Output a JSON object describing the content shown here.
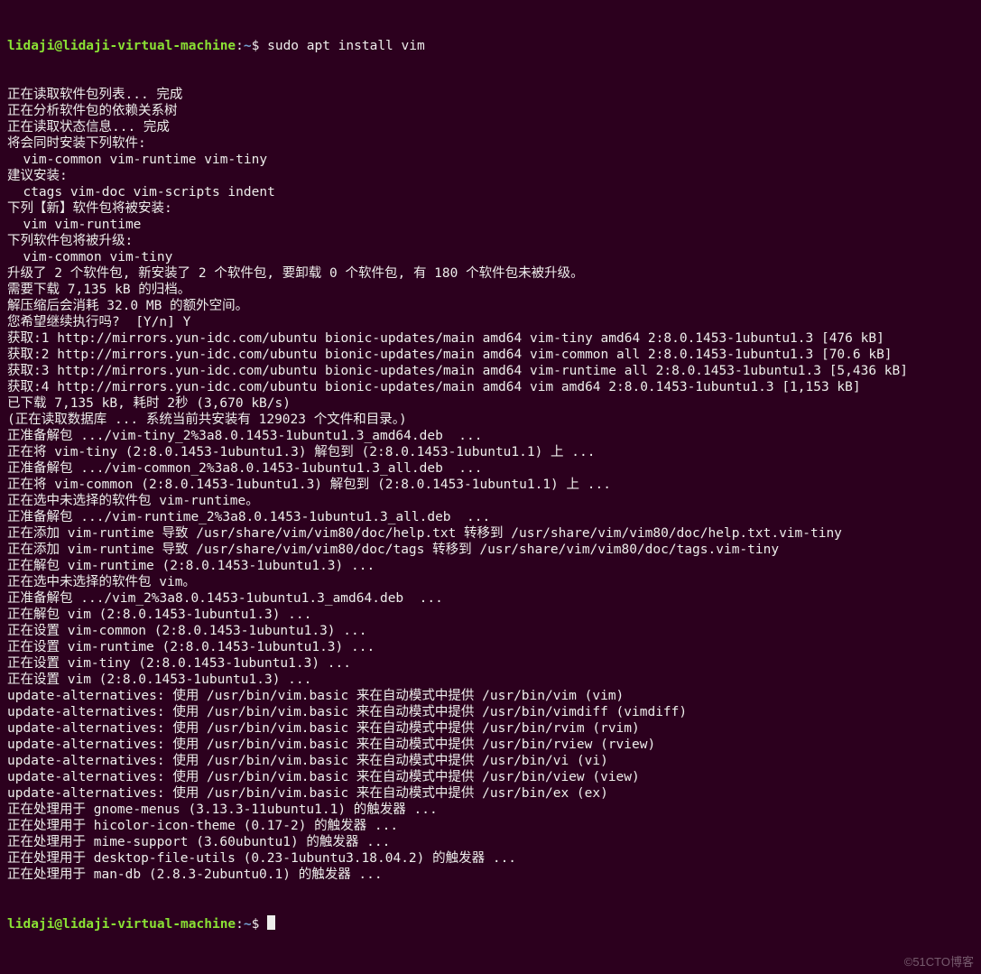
{
  "prompt": {
    "user_host": "lidaji@lidaji-virtual-machine",
    "colon": ":",
    "path": "~",
    "dollar": "$ "
  },
  "command": "sudo apt install vim",
  "lines": [
    "正在读取软件包列表... 完成",
    "正在分析软件包的依赖关系树",
    "正在读取状态信息... 完成",
    "将会同时安装下列软件:",
    "  vim-common vim-runtime vim-tiny",
    "建议安装:",
    "  ctags vim-doc vim-scripts indent",
    "下列【新】软件包将被安装:",
    "  vim vim-runtime",
    "下列软件包将被升级:",
    "  vim-common vim-tiny",
    "升级了 2 个软件包, 新安装了 2 个软件包, 要卸载 0 个软件包, 有 180 个软件包未被升级。",
    "需要下载 7,135 kB 的归档。",
    "解压缩后会消耗 32.0 MB 的额外空间。",
    "您希望继续执行吗?  [Y/n] Y",
    "获取:1 http://mirrors.yun-idc.com/ubuntu bionic-updates/main amd64 vim-tiny amd64 2:8.0.1453-1ubuntu1.3 [476 kB]",
    "获取:2 http://mirrors.yun-idc.com/ubuntu bionic-updates/main amd64 vim-common all 2:8.0.1453-1ubuntu1.3 [70.6 kB]",
    "获取:3 http://mirrors.yun-idc.com/ubuntu bionic-updates/main amd64 vim-runtime all 2:8.0.1453-1ubuntu1.3 [5,436 kB]",
    "获取:4 http://mirrors.yun-idc.com/ubuntu bionic-updates/main amd64 vim amd64 2:8.0.1453-1ubuntu1.3 [1,153 kB]",
    "已下载 7,135 kB, 耗时 2秒 (3,670 kB/s)",
    "(正在读取数据库 ... 系统当前共安装有 129023 个文件和目录。)",
    "正准备解包 .../vim-tiny_2%3a8.0.1453-1ubuntu1.3_amd64.deb  ...",
    "正在将 vim-tiny (2:8.0.1453-1ubuntu1.3) 解包到 (2:8.0.1453-1ubuntu1.1) 上 ...",
    "正准备解包 .../vim-common_2%3a8.0.1453-1ubuntu1.3_all.deb  ...",
    "正在将 vim-common (2:8.0.1453-1ubuntu1.3) 解包到 (2:8.0.1453-1ubuntu1.1) 上 ...",
    "正在选中未选择的软件包 vim-runtime。",
    "正准备解包 .../vim-runtime_2%3a8.0.1453-1ubuntu1.3_all.deb  ...",
    "正在添加 vim-runtime 导致 /usr/share/vim/vim80/doc/help.txt 转移到 /usr/share/vim/vim80/doc/help.txt.vim-tiny",
    "正在添加 vim-runtime 导致 /usr/share/vim/vim80/doc/tags 转移到 /usr/share/vim/vim80/doc/tags.vim-tiny",
    "正在解包 vim-runtime (2:8.0.1453-1ubuntu1.3) ...",
    "正在选中未选择的软件包 vim。",
    "正准备解包 .../vim_2%3a8.0.1453-1ubuntu1.3_amd64.deb  ...",
    "正在解包 vim (2:8.0.1453-1ubuntu1.3) ...",
    "正在设置 vim-common (2:8.0.1453-1ubuntu1.3) ...",
    "正在设置 vim-runtime (2:8.0.1453-1ubuntu1.3) ...",
    "正在设置 vim-tiny (2:8.0.1453-1ubuntu1.3) ...",
    "正在设置 vim (2:8.0.1453-1ubuntu1.3) ...",
    "update-alternatives: 使用 /usr/bin/vim.basic 来在自动模式中提供 /usr/bin/vim (vim)",
    "update-alternatives: 使用 /usr/bin/vim.basic 来在自动模式中提供 /usr/bin/vimdiff (vimdiff)",
    "update-alternatives: 使用 /usr/bin/vim.basic 来在自动模式中提供 /usr/bin/rvim (rvim)",
    "update-alternatives: 使用 /usr/bin/vim.basic 来在自动模式中提供 /usr/bin/rview (rview)",
    "update-alternatives: 使用 /usr/bin/vim.basic 来在自动模式中提供 /usr/bin/vi (vi)",
    "update-alternatives: 使用 /usr/bin/vim.basic 来在自动模式中提供 /usr/bin/view (view)",
    "update-alternatives: 使用 /usr/bin/vim.basic 来在自动模式中提供 /usr/bin/ex (ex)",
    "正在处理用于 gnome-menus (3.13.3-11ubuntu1.1) 的触发器 ...",
    "正在处理用于 hicolor-icon-theme (0.17-2) 的触发器 ...",
    "正在处理用于 mime-support (3.60ubuntu1) 的触发器 ...",
    "正在处理用于 desktop-file-utils (0.23-1ubuntu3.18.04.2) 的触发器 ...",
    "正在处理用于 man-db (2.8.3-2ubuntu0.1) 的触发器 ..."
  ],
  "watermark": "©51CTO博客"
}
